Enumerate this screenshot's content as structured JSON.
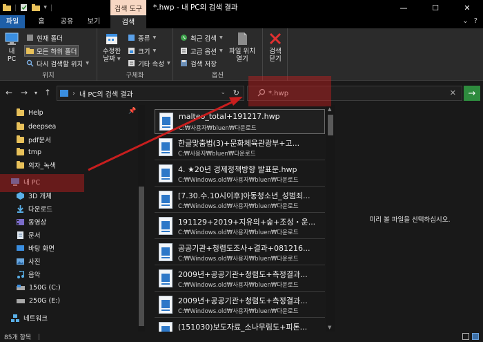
{
  "window": {
    "title": "*.hwp - 내 PC의 검색 결과",
    "context_tab": "검색 도구",
    "controls": [
      "—",
      "☐",
      "✕"
    ]
  },
  "tabs": {
    "file": "파일",
    "home": "홈",
    "share": "공유",
    "view": "보기",
    "search": "검색",
    "help": "?"
  },
  "ribbon": {
    "location": {
      "this_pc": "내\nPC",
      "current_folder": "현재 폴더",
      "all_subfolders": "모든 하위 폴더",
      "search_again": "다시 검색할 위치",
      "label": "위치"
    },
    "refine": {
      "date_modified": "수정한\n날짜",
      "kind": "종류",
      "size": "크기",
      "other_props": "기타 속성",
      "label": "구체화"
    },
    "options": {
      "recent_searches": "최근 검색",
      "advanced": "고급 옵션",
      "save_search": "검색 저장",
      "open_file_location": "파일 위치\n열기",
      "label": "옵션"
    },
    "close": {
      "close_search": "검색\n닫기"
    }
  },
  "address": {
    "path": "내 PC의 검색 결과",
    "search_value": "*.hwp"
  },
  "nav": {
    "items": [
      {
        "label": "Help",
        "type": "folder"
      },
      {
        "label": "deepsea",
        "type": "folder"
      },
      {
        "label": "pdf문서",
        "type": "folder"
      },
      {
        "label": "tmp",
        "type": "folder"
      },
      {
        "label": "의자_녹색",
        "type": "folder"
      },
      {
        "label": "내 PC",
        "type": "pc"
      },
      {
        "label": "3D 개체",
        "type": "3d"
      },
      {
        "label": "다운로드",
        "type": "download"
      },
      {
        "label": "동영상",
        "type": "video"
      },
      {
        "label": "문서",
        "type": "doc"
      },
      {
        "label": "바탕 화면",
        "type": "desktop"
      },
      {
        "label": "사진",
        "type": "picture"
      },
      {
        "label": "음악",
        "type": "music"
      },
      {
        "label": "150G (C:)",
        "type": "drive"
      },
      {
        "label": "250G (E:)",
        "type": "drive"
      },
      {
        "label": "네트워크",
        "type": "network"
      }
    ]
  },
  "results": [
    {
      "name": "malteo_total+191217.hwp",
      "path": "C:₩사용자₩bluen₩다운로드"
    },
    {
      "name": "한글맞춤법(3)+문화체육관광부+고...",
      "path": "C:₩사용자₩bluen₩다운로드"
    },
    {
      "name": "4. ★20년 경제정책방향 발표문.hwp",
      "path": "C:₩Windows.old₩사용자₩bluen₩다운로드"
    },
    {
      "name": "[7.30.수.10시이후]아동청소년_성범죄...",
      "path": "C:₩Windows.old₩사용자₩bluen₩다운로드"
    },
    {
      "name": "191129+2019+지유의+숲+조성・운...",
      "path": "C:₩Windows.old₩사용자₩bluen₩다운로드"
    },
    {
      "name": "공공기관+청렴도조사+결과+081216...",
      "path": "C:₩Windows.old₩사용자₩bluen₩다운로드"
    },
    {
      "name": "2009년+공공기관+청렴도+측정결과...",
      "path": "C:₩Windows.old₩사용자₩bluen₩다운로드"
    },
    {
      "name": "2009년+공공기관+청렴도+측정결과...",
      "path": "C:₩Windows.old₩사용자₩bluen₩다운로드"
    },
    {
      "name": "(151030)보도자료_소나무림도+피톤...",
      "path": ""
    }
  ],
  "preview": {
    "message": "미리 볼 파일을 선택하십시오."
  },
  "status": {
    "count": "85개 항목"
  },
  "colors": {
    "file_tab": "#1e5fa8",
    "context_tab": "#f7d7c3",
    "highlight": "#c81e1e",
    "search_go": "#2e8b3e"
  }
}
